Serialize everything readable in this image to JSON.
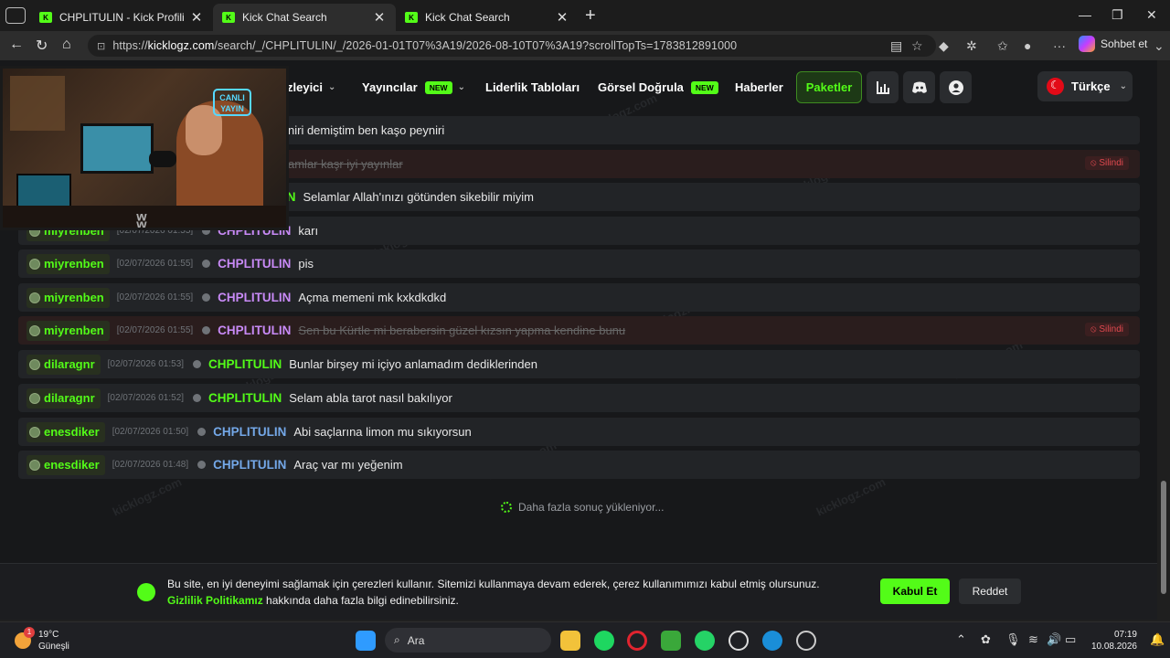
{
  "browser": {
    "tabs": [
      {
        "label": "CHPLITULIN - Kick Profili",
        "active": false
      },
      {
        "label": "Kick Chat Search",
        "active": true
      },
      {
        "label": "Kick Chat Search",
        "active": false
      }
    ],
    "url_prefix": "https://",
    "url_domain": "kicklogz.com",
    "url_rest": "/search/_/CHPLITULIN/_/2026-01-01T07%3A19/2026-08-10T07%3A19?scrollTopTs=1783812891000",
    "copilot_label": "Sohbet et"
  },
  "nav": {
    "partial_link": "zleyici",
    "yayincilar": "Yayıncılar",
    "liderlik": "Liderlik Tabloları",
    "gorsel": "Görsel Doğrula",
    "new_badge": "NEW",
    "haberler": "Haberler",
    "paketler": "Paketler",
    "language": "Türkçe"
  },
  "webcam": {
    "neon_text": "CANLI YAYIN"
  },
  "partial_rows": [
    {
      "msg": "niri demiştim ben kaşo peyniri",
      "deleted": false
    },
    {
      "msg": "amlar kaşr iyi yayınlar",
      "deleted": true
    },
    {
      "chan_tail": "IN",
      "msg": "Selamlar Allah'ınızı götünden sikebilir miyim",
      "deleted": false
    }
  ],
  "messages": [
    {
      "user": "miyrenben",
      "ts": "[02/07/2026 01:55]",
      "channel": "CHPLITULIN",
      "msg": "karı",
      "deleted": false,
      "chan_color": "purple"
    },
    {
      "user": "miyrenben",
      "ts": "[02/07/2026 01:55]",
      "channel": "CHPLITULIN",
      "msg": "pis",
      "deleted": false,
      "chan_color": "purple"
    },
    {
      "user": "miyrenben",
      "ts": "[02/07/2026 01:55]",
      "channel": "CHPLITULIN",
      "msg": "Açma memeni mk kxkdkdkd",
      "deleted": false,
      "chan_color": "purple"
    },
    {
      "user": "miyrenben",
      "ts": "[02/07/2026 01:55]",
      "channel": "CHPLITULIN",
      "msg": "Sen bu Kürtle mi berabersin güzel kızsın yapma kendine bunu",
      "deleted": true,
      "chan_color": "purple"
    },
    {
      "user": "dilaragnr",
      "ts": "[02/07/2026 01:53]",
      "channel": "CHPLITULIN",
      "msg": "Bunlar birşey mi içiyo anlamadım dediklerinden",
      "deleted": false,
      "chan_color": "green"
    },
    {
      "user": "dilaragnr",
      "ts": "[02/07/2026 01:52]",
      "channel": "CHPLITULIN",
      "msg": "Selam abla tarot nasıl bakılıyor",
      "deleted": false,
      "chan_color": "green"
    },
    {
      "user": "enesdiker",
      "ts": "[02/07/2026 01:50]",
      "channel": "CHPLITULIN",
      "msg": "Abi saçlarına limon mu sıkıyorsun",
      "deleted": false,
      "chan_color": "blue"
    },
    {
      "user": "enesdiker",
      "ts": "[02/07/2026 01:48]",
      "channel": "CHPLITULIN",
      "msg": "Araç var mı yeğenim",
      "deleted": false,
      "chan_color": "blue"
    }
  ],
  "deleted_label": "Silindi",
  "load_more": "Daha fazla sonuç yükleniyor...",
  "cookie": {
    "text": "Bu site, en iyi deneyimi sağlamak için çerezleri kullanır. Sitemizi kullanmaya devam ederek, çerez kullanımımızı kabul etmiş olursunuz.",
    "link": "Gizlilik Politikamız",
    "text2": "hakkında daha fazla bilgi edinebilirsiniz.",
    "accept": "Kabul Et",
    "reject": "Reddet"
  },
  "taskbar": {
    "temp": "19°C",
    "weather": "Güneşli",
    "weather_badge": "1",
    "search": "Ara",
    "time": "07:19",
    "date": "10.08.2026"
  },
  "colors": {
    "accent": "#53fc18",
    "channel_purple": "#c88af6",
    "channel_blue": "#74a8e8",
    "deleted_red": "#e0494f"
  }
}
